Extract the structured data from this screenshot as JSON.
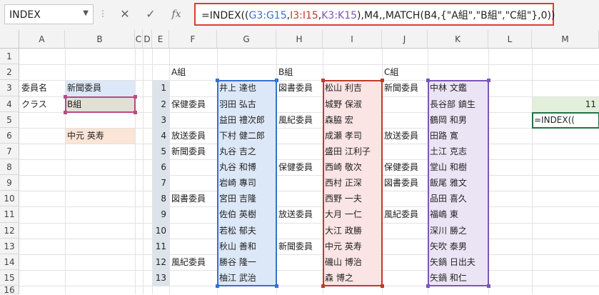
{
  "formula_bar": {
    "name_box": "INDEX",
    "formula_parts": [
      {
        "t": "=INDEX((",
        "c": "k"
      },
      {
        "t": "G3:G15",
        "c": "b"
      },
      {
        "t": ",",
        "c": "k"
      },
      {
        "t": "I3:I15",
        "c": "r"
      },
      {
        "t": ",",
        "c": "k"
      },
      {
        "t": "K3:K15",
        "c": "p"
      },
      {
        "t": "),M4,,MATCH(B4,{\"A組\",\"B組\",\"C組\"},0))",
        "c": "k"
      }
    ]
  },
  "columns": [
    "A",
    "B",
    "C",
    "D",
    "E",
    "F",
    "G",
    "H",
    "I",
    "J",
    "K",
    "L",
    "M"
  ],
  "rows": [
    "1",
    "2",
    "3",
    "4",
    "5",
    "6",
    "7",
    "8",
    "9",
    "10",
    "11",
    "12",
    "13",
    "14",
    "15",
    "16"
  ],
  "colors": {
    "blue_fill": "#dce8f7",
    "blue_border": "#3a6fcf",
    "red_fill": "#fbe4e4",
    "red_border": "#c0392b",
    "purple_fill": "#ebe4f5",
    "purple_border": "#7b56b8",
    "green_fill": "#e2efda",
    "orange_fill": "#fce4d6",
    "b4_fill": "#dfe1d4",
    "b4_border": "#b84a84"
  },
  "lookup": {
    "label_committee": "委員名",
    "committee": "新聞委員",
    "label_class": "クラス",
    "class": "B組",
    "result": "中元 英寿",
    "m4": "11",
    "m5": "=INDEX(("
  },
  "group_headers": {
    "a": "A組",
    "b": "B組",
    "c": "C組"
  },
  "row_numbers": [
    "1",
    "2",
    "3",
    "4",
    "5",
    "6",
    "7",
    "8",
    "9",
    "10",
    "11",
    "12",
    "13"
  ],
  "committee_a": [
    "",
    "保健委員",
    "",
    "放送委員",
    "新聞委員",
    "",
    "",
    "図書委員",
    "",
    "",
    "",
    "風紀委員",
    ""
  ],
  "names_a": [
    "井上 達也",
    "羽田 弘古",
    "益田 禮次郎",
    "下村 健二郎",
    "丸谷 吉之",
    "丸谷 和博",
    "岩崎 專司",
    "宮田 吉隆",
    "佐伯 英樹",
    "若松 郁夫",
    "秋山 善和",
    "勝谷 隆一",
    "柚江 武治"
  ],
  "committee_b": [
    "図書委員",
    "",
    "風紀委員",
    "",
    "",
    "保健委員",
    "",
    "",
    "放送委員",
    "",
    "新聞委員",
    "",
    ""
  ],
  "names_b": [
    "松山 利吉",
    "城野 保淑",
    "森脇 宏",
    "成瀬 孝司",
    "盛田 江利子",
    "西崎 敬次",
    "西村 正深",
    "西野 一夫",
    "大月 一仁",
    "大江 政勝",
    "中元 英寿",
    "磯山 博治",
    "森 博之"
  ],
  "committee_c": [
    "新聞委員",
    "",
    "",
    "放送委員",
    "",
    "保健委員",
    "図書委員",
    "",
    "風紀委員",
    "",
    "",
    "",
    ""
  ],
  "names_c": [
    "中林 文鑑",
    "長谷部 鎮生",
    "鶴岡 和男",
    "田路 寛",
    "土江 克志",
    "堂山 和樹",
    "飯尾 雅文",
    "品田 喜久",
    "福嶋 東",
    "深川 勝之",
    "矢吹 泰男",
    "矢鍋 日出夫",
    "矢鍋 和仁"
  ]
}
